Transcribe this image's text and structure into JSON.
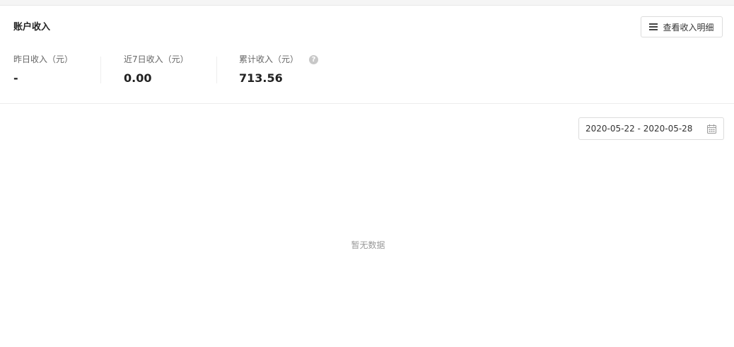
{
  "card": {
    "title": "账户收入",
    "detail_button_label": "查看收入明细"
  },
  "stats": [
    {
      "label": "昨日收入（元）",
      "value": "-"
    },
    {
      "label": "近7日收入（元）",
      "value": "0.00"
    },
    {
      "label": "累计收入（元）",
      "value": "713.56",
      "help": "?"
    }
  ],
  "filter": {
    "date_range": "2020-05-22 - 2020-05-28"
  },
  "empty_state": {
    "text": "暂无数据"
  },
  "icons": {
    "detail_button": "list-icon",
    "date_range": "calendar-icon",
    "help": "help-icon"
  }
}
